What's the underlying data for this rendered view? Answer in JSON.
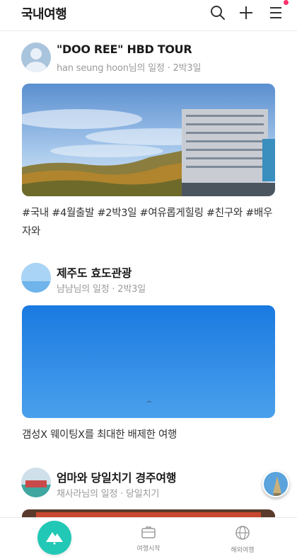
{
  "header": {
    "title": "국내여행",
    "icons": [
      "search-icon",
      "plus-icon",
      "menu-icon"
    ],
    "notification_color": "#ff2e6a"
  },
  "posts": [
    {
      "title": "\"DOO REE\" HBD TOUR",
      "author": "han seung hoon",
      "meta": "님의 일정 · 2박3일",
      "caption": "#국내 #4월출발 #2박3일 #여유롭게힐링 #친구와 #배우자와"
    },
    {
      "title": "제주도 효도관광",
      "author": "냠냠",
      "meta": "님의 일정 · 2박3일",
      "caption": "갬성X 웨이팅X를 최대한 배제한 여행"
    },
    {
      "title": "엄마와 당일치기 경주여행",
      "author": "채사라",
      "meta": "님의 일정 · 당일치기",
      "caption": ""
    }
  ],
  "bottom_nav": {
    "home_icon": "home-mountain-icon",
    "items": [
      {
        "label": "여행시작",
        "icon": "suitcase-icon"
      },
      {
        "label": "해외여행",
        "icon": "globe-icon"
      }
    ]
  },
  "colors": {
    "accent": "#22c8b6",
    "text": "#1a1a1a",
    "subtext": "#9a9a9a"
  }
}
